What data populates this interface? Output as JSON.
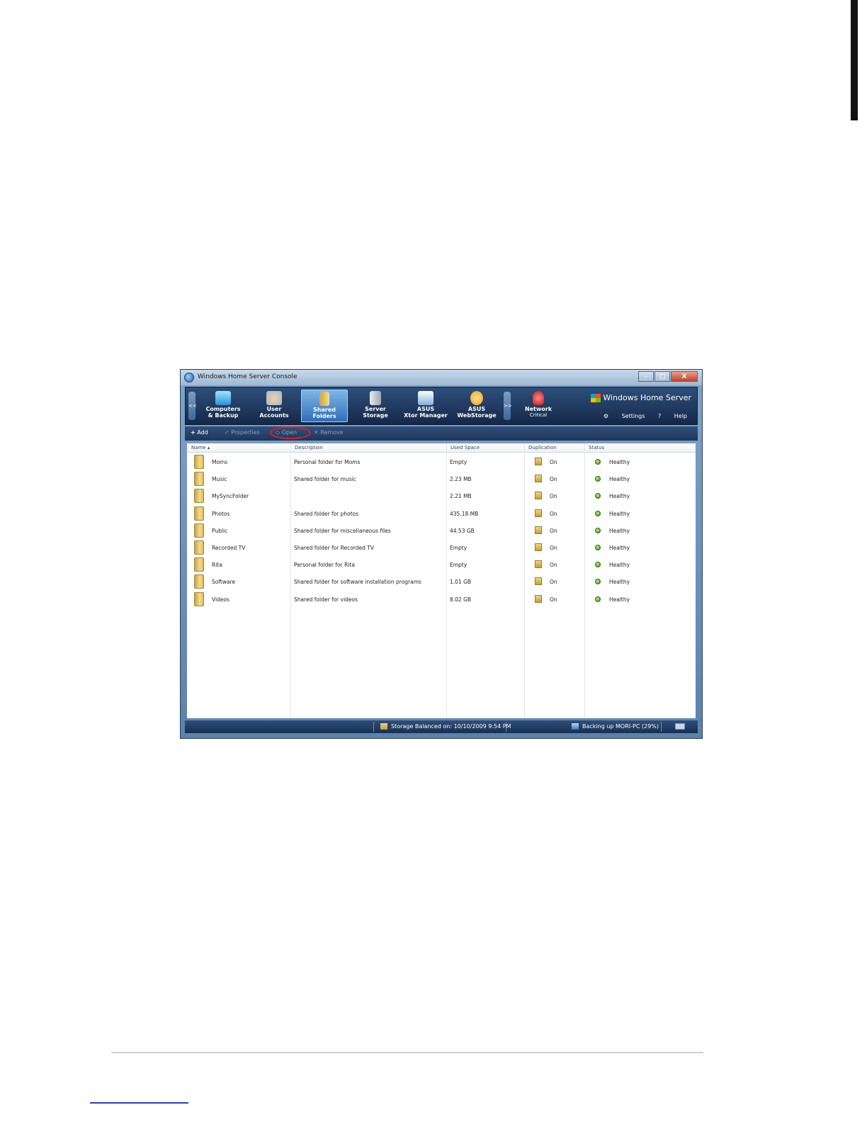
{
  "window": {
    "title": "Windows Home Server Console",
    "buttons": {
      "minimize": "–",
      "maximize": "□",
      "close": "X"
    }
  },
  "nav": {
    "scroll_left": "<<",
    "scroll_right": ">>",
    "items": [
      {
        "label": "Computers\n& Backup",
        "icon": "computers-icon",
        "active": false
      },
      {
        "label": "User\nAccounts",
        "icon": "users-icon",
        "active": false
      },
      {
        "label": "Shared\nFolders",
        "icon": "shared-folders-icon",
        "active": true
      },
      {
        "label": "Server\nStorage",
        "icon": "server-storage-icon",
        "active": false
      },
      {
        "label": "ASUS\nXtor Manager",
        "icon": "xtor-manager-icon",
        "active": false
      },
      {
        "label": "ASUS\nWebStorage",
        "icon": "webstorage-icon",
        "active": false
      }
    ],
    "network": {
      "label": "Network",
      "sub": "Critical"
    },
    "brand": "Windows Home Server",
    "settings": "Settings",
    "help": "Help"
  },
  "toolbar": {
    "add": "Add",
    "properties": "Properties",
    "open": "Open",
    "remove": "Remove"
  },
  "table": {
    "columns": [
      "Name",
      "Description",
      "Used Space",
      "Duplication",
      "Status"
    ],
    "rows": [
      {
        "name": "Moms",
        "description": "Personal folder for Moms",
        "used": "Empty",
        "dup": "On",
        "status": "Healthy"
      },
      {
        "name": "Music",
        "description": "Shared folder for music",
        "used": "2.23 MB",
        "dup": "On",
        "status": "Healthy"
      },
      {
        "name": "MySyncFolder",
        "description": "",
        "used": "2.21 MB",
        "dup": "On",
        "status": "Healthy"
      },
      {
        "name": "Photos",
        "description": "Shared folder for photos",
        "used": "435.18 MB",
        "dup": "On",
        "status": "Healthy"
      },
      {
        "name": "Public",
        "description": "Shared folder for miscellaneous files",
        "used": "44.53 GB",
        "dup": "On",
        "status": "Healthy"
      },
      {
        "name": "Recorded TV",
        "description": "Shared folder for Recorded TV",
        "used": "Empty",
        "dup": "On",
        "status": "Healthy"
      },
      {
        "name": "Rita",
        "description": "Personal folder for Rita",
        "used": "Empty",
        "dup": "On",
        "status": "Healthy"
      },
      {
        "name": "Software",
        "description": "Shared folder for software installation programs",
        "used": "1.01 GB",
        "dup": "On",
        "status": "Healthy"
      },
      {
        "name": "Videos",
        "description": "Shared folder for videos",
        "used": "8.02 GB",
        "dup": "On",
        "status": "Healthy"
      }
    ]
  },
  "statusbar": {
    "storage": "Storage Balanced on: 10/10/2009 9:54 PM",
    "backup": "Backing up MORI-PC (29%)"
  }
}
